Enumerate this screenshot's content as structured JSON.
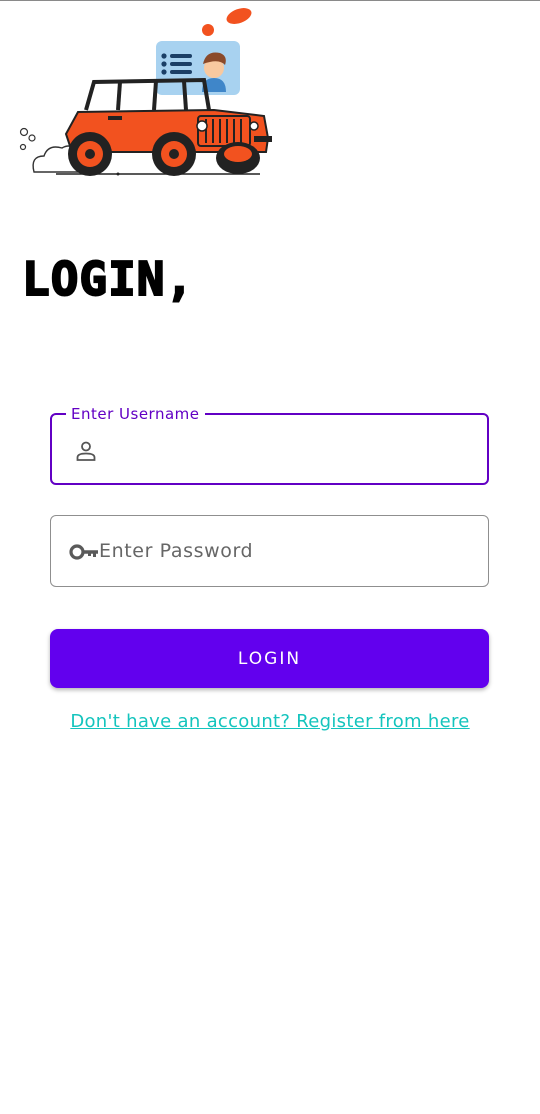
{
  "header": {
    "title": "LOGIN,"
  },
  "form": {
    "username": {
      "label": "Enter Username",
      "value": "",
      "icon": "person-icon"
    },
    "password": {
      "placeholder": "Enter Password",
      "value": "",
      "icon": "key-icon"
    },
    "submit_label": "LOGIN",
    "register_link": "Don't have an account? Register from here"
  },
  "colors": {
    "accent": "#6200ee",
    "focused_border": "#6200c4",
    "link": "#14c4bd",
    "jeep": "#f2521f"
  }
}
